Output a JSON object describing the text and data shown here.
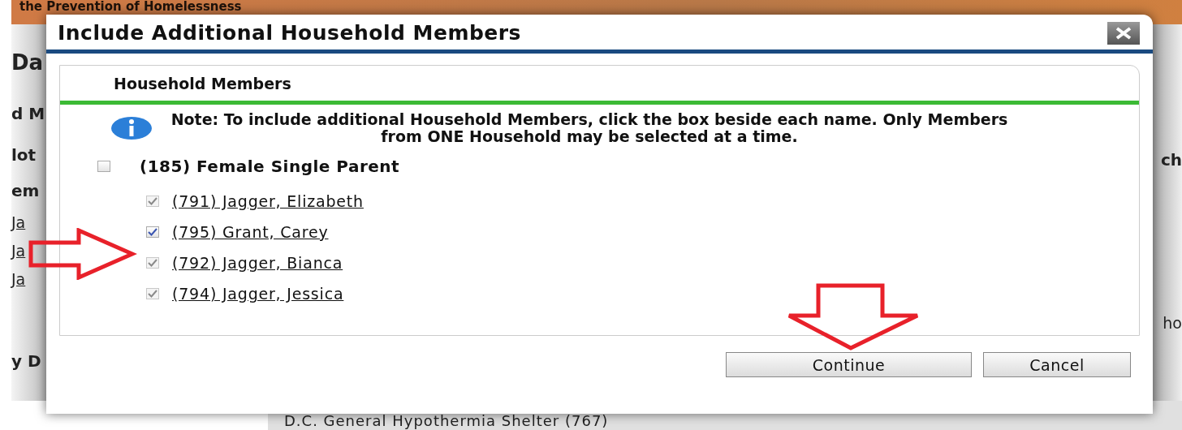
{
  "background": {
    "banner": "the Prevention of Homelessness",
    "left_fragments": [
      {
        "text": "Da",
        "kind": "heading"
      },
      {
        "text": "d M",
        "kind": "heading"
      },
      {
        "text": "lot",
        "kind": "heading"
      },
      {
        "text": "em",
        "kind": "heading"
      },
      {
        "text": "Ja",
        "kind": "link"
      },
      {
        "text": "Ja",
        "kind": "link"
      },
      {
        "text": "Ja",
        "kind": "link"
      },
      {
        "text": "y D",
        "kind": "heading"
      }
    ],
    "right_fragments": [
      {
        "text": "ch",
        "kind": "heading"
      },
      {
        "text": "ho",
        "kind": "cell"
      }
    ],
    "footer": "D.C. General Hypothermia Shelter (767)"
  },
  "dialog": {
    "title": "Include Additional Household Members",
    "section": "Household Members",
    "note": "Note: To include additional Household Members, click the box beside each name. Only Members from ONE Household may be selected at a time.",
    "household": {
      "label": "(185) Female Single Parent",
      "checked": false
    },
    "members": [
      {
        "label": "(791) Jagger, Elizabeth",
        "checked": true,
        "disabled": true
      },
      {
        "label": "(795) Grant, Carey",
        "checked": true,
        "disabled": false
      },
      {
        "label": "(792) Jagger, Bianca",
        "checked": true,
        "disabled": true
      },
      {
        "label": "(794) Jagger, Jessica",
        "checked": true,
        "disabled": true
      }
    ],
    "buttons": [
      "Continue",
      "Cancel"
    ]
  }
}
